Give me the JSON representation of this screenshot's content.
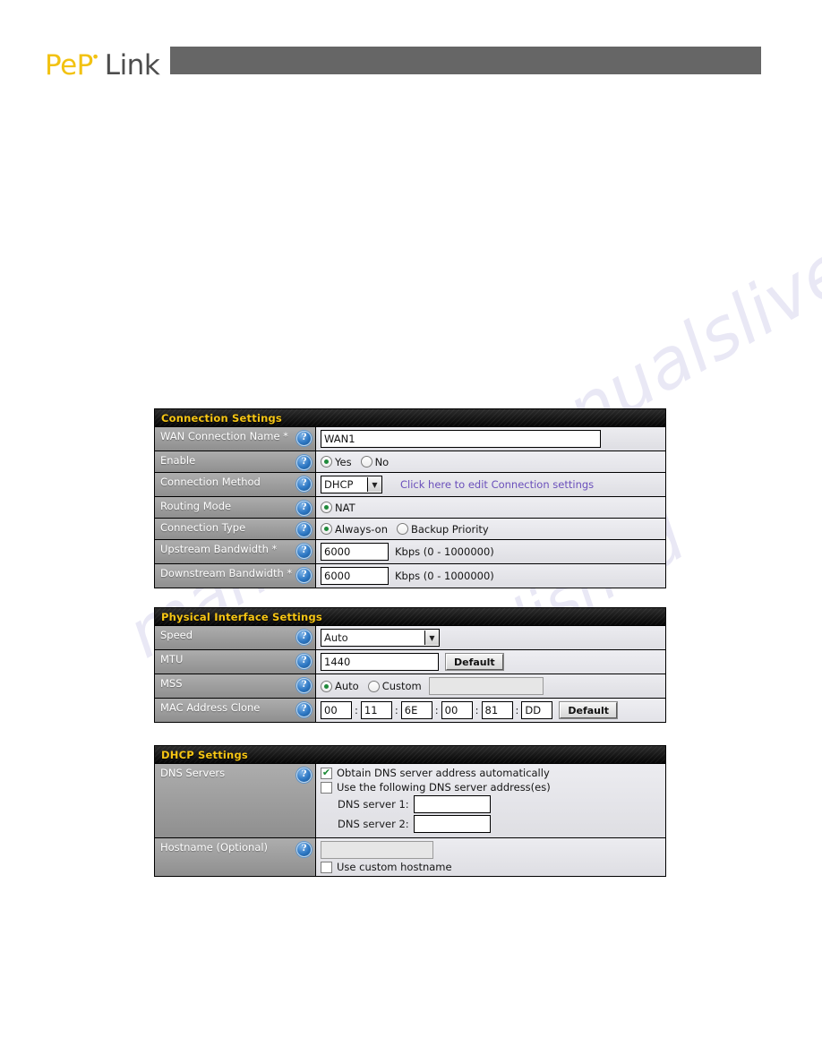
{
  "brand": {
    "logo_primary": "PeP",
    "logo_mark": "•",
    "logo_secondary": "Link",
    "logo_color": "#f2c212",
    "logo_secondary_color": "#4d4d4d",
    "header_bar_color": "#666666"
  },
  "watermark": {
    "line1": "anualslive.com",
    "line2": "manualslive",
    "line3": "published"
  },
  "panels": [
    {
      "id": "connection",
      "title": "Connection Settings",
      "rows": [
        {
          "label": "WAN Connection Name *",
          "help": "help-icon",
          "control": "text",
          "value": "WAN1"
        },
        {
          "label": "Enable",
          "help": "help-icon",
          "control": "radio",
          "options": [
            {
              "label": "Yes",
              "selected": true
            },
            {
              "label": "No",
              "selected": false
            }
          ]
        },
        {
          "label": "Connection Method",
          "help": "help-icon",
          "control": "select-link",
          "selected": "DHCP",
          "link_text": "Click here to edit Connection settings",
          "link_color": "#6a4fbb"
        },
        {
          "label": "Routing Mode",
          "help": "help-icon",
          "control": "radio",
          "options": [
            {
              "label": "NAT",
              "selected": true
            }
          ]
        },
        {
          "label": "Connection Type",
          "help": "help-icon",
          "control": "radio",
          "options": [
            {
              "label": "Always-on",
              "selected": true
            },
            {
              "label": "Backup Priority",
              "selected": false
            }
          ]
        },
        {
          "label": "Upstream Bandwidth *",
          "help": "help-icon",
          "control": "text-unit",
          "value": "6000",
          "unit": "Kbps (0 - 1000000)"
        },
        {
          "label": "Downstream Bandwidth *",
          "help": "help-icon",
          "control": "text-unit",
          "value": "6000",
          "unit": "Kbps (0 - 1000000)"
        }
      ]
    },
    {
      "id": "physical",
      "title": "Physical Interface Settings",
      "rows": [
        {
          "label": "Speed",
          "help": "help-icon",
          "control": "select",
          "selected": "Auto"
        },
        {
          "label": "MTU",
          "help": "help-icon",
          "control": "text-button",
          "value": "1440",
          "button": "Default"
        },
        {
          "label": "MSS",
          "help": "help-icon",
          "control": "radio-text",
          "options": [
            {
              "label": "Auto",
              "selected": true
            },
            {
              "label": "Custom",
              "selected": false
            }
          ],
          "value": ""
        },
        {
          "label": "MAC Address Clone",
          "help": "help-icon",
          "control": "mac",
          "octets": [
            "00",
            "11",
            "6E",
            "00",
            "81",
            "DD"
          ],
          "separator": ":",
          "button": "Default"
        }
      ]
    },
    {
      "id": "dhcp",
      "title": "DHCP Settings",
      "rows": [
        {
          "label": "DNS Servers",
          "help": "help-icon",
          "control": "dns",
          "checks": [
            {
              "label": "Obtain DNS server address automatically",
              "checked": true
            },
            {
              "label": "Use the following DNS server address(es)",
              "checked": false
            }
          ],
          "fields": [
            {
              "label": "DNS server 1:",
              "value": ""
            },
            {
              "label": "DNS server 2:",
              "value": ""
            }
          ]
        },
        {
          "label": "Hostname (Optional)",
          "help": "help-icon",
          "control": "hostname",
          "value": "",
          "checks": [
            {
              "label": "Use custom hostname",
              "checked": false
            }
          ]
        }
      ]
    }
  ],
  "glyphs": {
    "help": "?",
    "check": "✔",
    "caret_down": "▼"
  }
}
